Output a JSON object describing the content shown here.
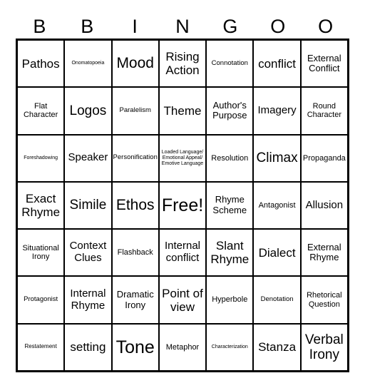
{
  "header": [
    "B",
    "B",
    "I",
    "N",
    "G",
    "O",
    "O"
  ],
  "cells": [
    [
      "Pathos",
      "Onomatopoeia",
      "Mood",
      "Rising Action",
      "Connotation",
      "conflict",
      "External Conflict"
    ],
    [
      "Flat Character",
      "Logos",
      "Paralelism",
      "Theme",
      "Author's Purpose",
      "Imagery",
      "Round Character"
    ],
    [
      "Foreshadowing",
      "Speaker",
      "Personification",
      "Loaded Language/ Emotional Appeal/ Emotive Language",
      "Resolution",
      "Climax",
      "Propaganda"
    ],
    [
      "Exact Rhyme",
      "Simile",
      "Ethos",
      "Free!",
      "Rhyme Scheme",
      "Antagonist",
      "Allusion"
    ],
    [
      "Situational Irony",
      "Context Clues",
      "Flashback",
      "Internal conflict",
      "Slant Rhyme",
      "Dialect",
      "External Rhyme"
    ],
    [
      "Protagonist",
      "Internal Rhyme",
      "Dramatic Irony",
      "Point of view",
      "Hyperbole",
      "Denotation",
      "Rhetorical Question"
    ],
    [
      "Restatement",
      "setting",
      "Tone",
      "Metaphor",
      "Characterization",
      "Stanza",
      "Verbal Irony"
    ]
  ]
}
